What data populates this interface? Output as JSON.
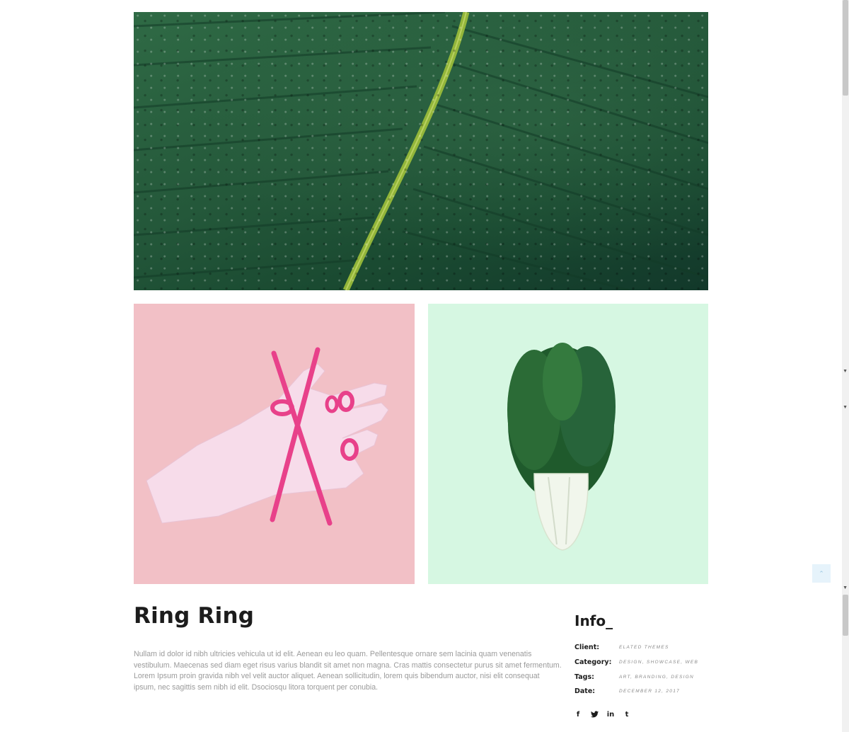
{
  "project": {
    "title": "Ring Ring",
    "description": "Nullam id dolor id nibh ultricies vehicula ut id elit. Aenean eu leo quam. Pellentesque ornare sem lacinia quam venenatis vestibulum. Maecenas sed diam eget risus varius blandit sit amet non magna. Cras mattis consectetur purus sit amet fermentum. Lorem Ipsum proin gravida nibh vel velit auctor aliquet. Aenean sollicitudin, lorem quis bibendum auctor, nisi elit consequat ipsum, nec sagittis sem nibh id elit. Dsociosqu litora torquent per conubia."
  },
  "info": {
    "title": "Info_",
    "rows": [
      {
        "label": "Client:",
        "value": "Elated Themes"
      },
      {
        "label": "Category:",
        "value": "Design, Showcase, Web"
      },
      {
        "label": "Tags:",
        "value": "Art, Branding, Design"
      },
      {
        "label": "Date:",
        "value": "December 12, 2017"
      }
    ],
    "social": [
      {
        "icon": "facebook-icon",
        "glyph": "f"
      },
      {
        "icon": "twitter-icon",
        "glyph": "🐦"
      },
      {
        "icon": "linkedin-icon",
        "glyph": "in"
      },
      {
        "icon": "tumblr-icon",
        "glyph": "t"
      }
    ]
  },
  "colors": {
    "leaf": "#24583a",
    "pink_bg": "#f2c0c6",
    "mint_bg": "#d6f7e2",
    "accent_pink": "#e8418a"
  },
  "back_to_top": "⌃"
}
